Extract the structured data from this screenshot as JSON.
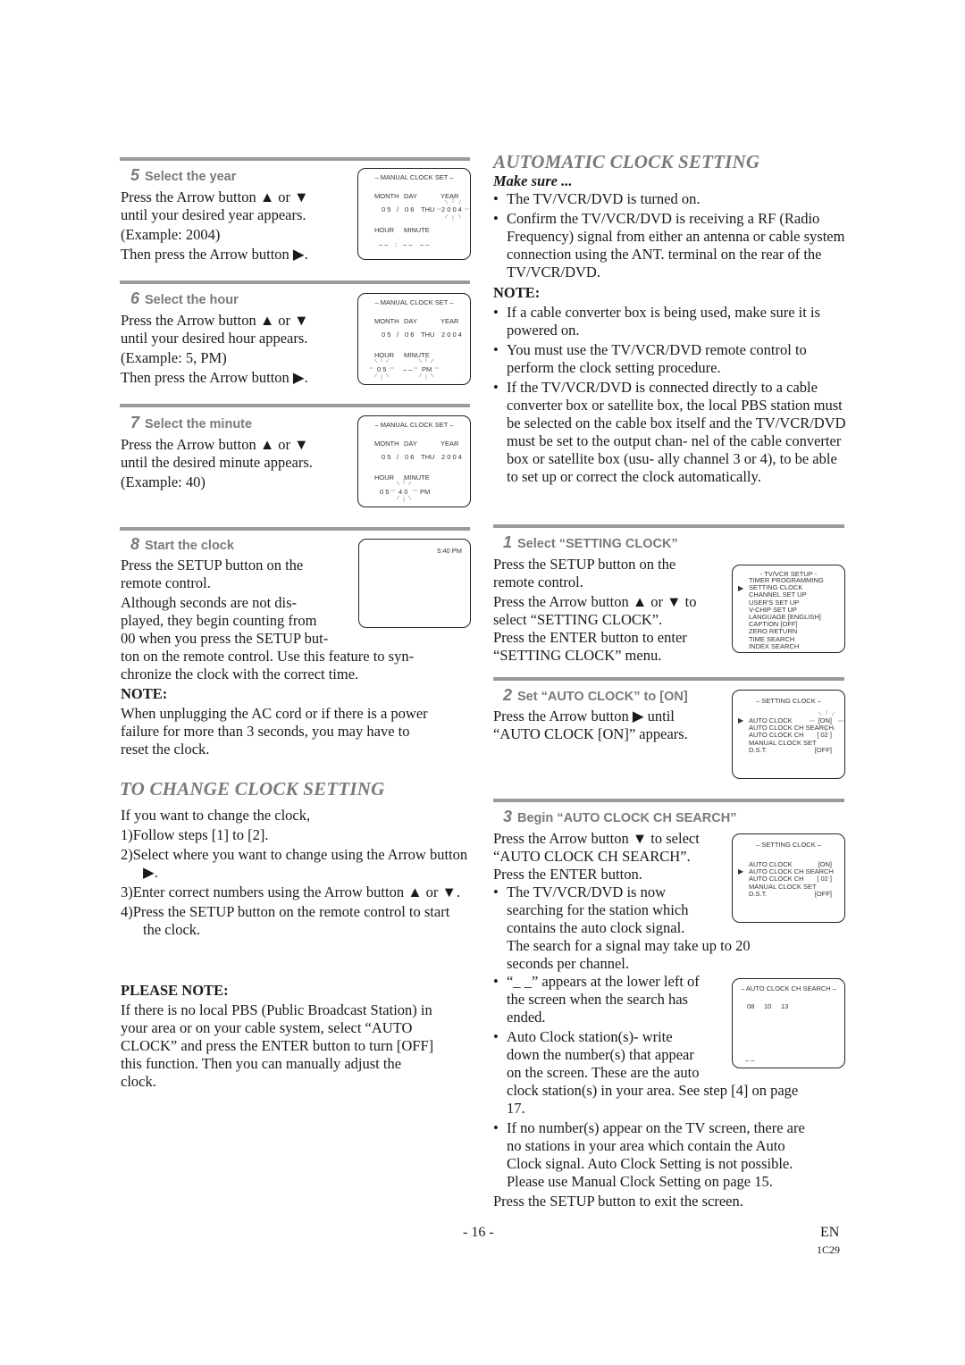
{
  "left": {
    "step5": {
      "num": "5",
      "title": "Select the year",
      "lines": [
        "Press the Arrow button ▲ or ▼",
        "until your desired year appears.",
        "(Example: 2004)",
        "Then press the Arrow button ▶."
      ],
      "screen": {
        "title": "– MANUAL CLOCK SET –",
        "labels_row1": [
          "MONTH",
          "DAY",
          "YEAR"
        ],
        "values_row1": [
          "0 5",
          "/",
          "0 6",
          "THU",
          "2 0 0 4"
        ],
        "labels_row2": [
          "HOUR",
          "MINUTE"
        ],
        "values_row2": [
          "– –",
          ":",
          "– –",
          "– –"
        ],
        "blinking": "year"
      }
    },
    "step6": {
      "num": "6",
      "title": "Select the hour",
      "lines": [
        "Press the Arrow button ▲ or ▼",
        "until your desired hour appears.",
        "(Example: 5, PM)",
        "Then press the Arrow button ▶."
      ],
      "screen": {
        "title": "– MANUAL CLOCK SET –",
        "labels_row1": [
          "MONTH",
          "DAY",
          "YEAR"
        ],
        "values_row1": [
          "0 5",
          "/",
          "0 6",
          "THU",
          "2 0 0 4"
        ],
        "labels_row2": [
          "HOUR",
          "MINUTE"
        ],
        "values_row2": [
          "0 5",
          "– –",
          "PM"
        ],
        "blinking": "hour"
      }
    },
    "step7": {
      "num": "7",
      "title": "Select the minute",
      "lines": [
        "Press the Arrow button ▲ or ▼",
        "until the desired minute appears.",
        "(Example: 40)"
      ],
      "screen": {
        "title": "– MANUAL CLOCK SET –",
        "labels_row1": [
          "MONTH",
          "DAY",
          "YEAR"
        ],
        "values_row1": [
          "0 5",
          "/",
          "0 6",
          "THU",
          "2 0 0 4"
        ],
        "labels_row2": [
          "HOUR",
          "MINUTE"
        ],
        "values_row2": [
          "0 5",
          "4 0",
          "PM"
        ],
        "blinking": "minute"
      }
    },
    "step8": {
      "num": "8",
      "title": "Start the clock",
      "lines": [
        "Press the SETUP button on the",
        "remote control.",
        "Although seconds are not dis-",
        "played, they begin counting from",
        "00 when you press the SETUP but-",
        "ton on the remote control. Use this feature to syn-",
        "chronize the clock with the correct time."
      ],
      "screen": {
        "time": "5:40 PM"
      },
      "note_label": "NOTE:",
      "note_lines": [
        "When unplugging the AC cord or if there is a power",
        "failure for more than 3 seconds, you may have to",
        "reset the clock."
      ]
    },
    "change": {
      "heading": "TO CHANGE CLOCK SETTING",
      "intro": "If you want to change the clock,",
      "items": [
        "1)Follow steps [1] to [2].",
        "2)Select where you want to change using the Arrow button ▶.",
        "3)Enter correct numbers using the Arrow button ▲ or ▼.",
        "4)Press the SETUP button on the remote control to start the clock."
      ],
      "please_note_label": "PLEASE NOTE:",
      "please_note_lines": [
        "If there is no local PBS (Public Broadcast Station) in",
        "your area or on your cable system, select “AUTO",
        "CLOCK” and press the ENTER button to turn [OFF]",
        "this function. Then you can manually adjust the",
        "clock."
      ]
    }
  },
  "right": {
    "heading": "AUTOMATIC CLOCK SETTING",
    "make_sure": "Make sure ...",
    "make_sure_items": [
      "The TV/VCR/DVD is turned on.",
      "Confirm the TV/VCR/DVD is receiving a RF (Radio Frequency) signal from either an antenna or cable system connection using the ANT. terminal on the rear of the TV/VCR/DVD."
    ],
    "note_label": "NOTE:",
    "note_items": [
      "If a cable converter box is being used, make sure it is powered on.",
      "You must use the TV/VCR/DVD remote control to perform the clock setting procedure.",
      "If the TV/VCR/DVD is connected directly to a cable converter box or satellite box, the local PBS station must be selected on the cable box itself and the TV/VCR/DVD must be set to the output chan- nel of the cable converter box or satellite box (usu- ally channel 3 or 4), to be able to set up or correct the clock automatically."
    ],
    "step1": {
      "num": "1",
      "title": "Select “SETTING CLOCK”",
      "lines": [
        "Press the SETUP button on the",
        "remote control.",
        "Press the Arrow button ▲ or ▼ to",
        "select “SETTING CLOCK”.",
        "Press the ENTER button to enter",
        "“SETTING CLOCK” menu."
      ],
      "screen": {
        "title": "- TV/VCR SETUP -",
        "items": [
          "TIMER PROGRAMMING",
          "SETTING CLOCK",
          "CHANNEL SET UP",
          "USER'S SET UP",
          "V-CHIP SET UP",
          "LANGUAGE  [ENGLISH]",
          "CAPTION  [OFF]",
          "ZERO RETURN",
          "TIME SEARCH",
          "INDEX SEARCH"
        ],
        "selected_index": 1
      }
    },
    "step2": {
      "num": "2",
      "title": "Set “AUTO CLOCK” to [ON]",
      "lines": [
        "Press the Arrow button ▶ until",
        "“AUTO CLOCK [ON]” appears."
      ],
      "screen": {
        "title": "– SETTING CLOCK –",
        "items": [
          {
            "label": "AUTO CLOCK",
            "value": "[ON]"
          },
          {
            "label": "AUTO CLOCK CH SEARCH",
            "value": ""
          },
          {
            "label": "AUTO CLOCK CH",
            "value": "[ 02 ]"
          },
          {
            "label": "MANUAL CLOCK SET",
            "value": ""
          },
          {
            "label": "D.S.T.",
            "value": "[OFF]"
          }
        ],
        "selected_index": 0,
        "blinking": "[ON]"
      }
    },
    "step3": {
      "num": "3",
      "title": "Begin “AUTO CLOCK CH SEARCH”",
      "lines": [
        "Press the Arrow button ▼ to select",
        "“AUTO CLOCK CH SEARCH”.",
        "Press the ENTER button."
      ],
      "bullets": [
        {
          "lines": [
            "The TV/VCR/DVD is now",
            "searching for the station which",
            "contains the auto clock signal.",
            "The search for a signal may take up to 20",
            "seconds per channel."
          ]
        },
        {
          "lines": [
            "“_ _” appears at the lower left of",
            "the screen when the search has",
            "ended."
          ]
        },
        {
          "lines": [
            "Auto Clock station(s)- write",
            "down the number(s) that appear",
            "on the screen. These are the auto",
            "clock station(s) in your area. See step [4] on page",
            "17."
          ]
        },
        {
          "lines": [
            "If no number(s) appear on the TV screen, there are",
            "no stations in your area which contain the Auto",
            "Clock signal. Auto Clock Setting is not possible.",
            "Please use Manual Clock Setting on page 15."
          ]
        }
      ],
      "exit_line": "Press the SETUP button to exit the screen.",
      "screen": {
        "title": "– SETTING CLOCK –",
        "items": [
          {
            "label": "AUTO CLOCK",
            "value": "[ON]"
          },
          {
            "label": "AUTO CLOCK CH SEARCH",
            "value": ""
          },
          {
            "label": "AUTO CLOCK CH",
            "value": "[ 02 ]"
          },
          {
            "label": "MANUAL CLOCK SET",
            "value": ""
          },
          {
            "label": "D.S.T.",
            "value": "[OFF]"
          }
        ],
        "selected_index": 1
      },
      "search_screen": {
        "title": "– AUTO CLOCK CH SEARCH –",
        "channels": [
          "08",
          "10",
          "13"
        ],
        "end_marker": "– –"
      }
    }
  },
  "footer": {
    "page": "- 16 -",
    "lang": "EN",
    "code": "1C29"
  }
}
